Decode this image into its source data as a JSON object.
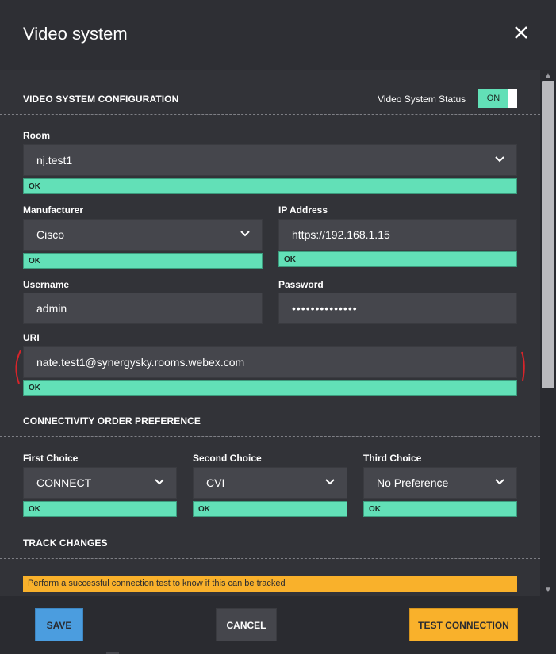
{
  "header": {
    "title": "Video system",
    "close_icon": "close-icon"
  },
  "config": {
    "section_title": "VIDEO SYSTEM CONFIGURATION",
    "status_label": "Video System Status",
    "status_toggle": "ON"
  },
  "room": {
    "label": "Room",
    "value": "nj.test1",
    "status": "OK"
  },
  "manufacturer": {
    "label": "Manufacturer",
    "value": "Cisco",
    "status": "OK"
  },
  "ip": {
    "label": "IP Address",
    "value": "https://192.168.1.15",
    "status": "OK"
  },
  "username": {
    "label": "Username",
    "value": "admin"
  },
  "password": {
    "label": "Password",
    "value": "••••••••••••••"
  },
  "uri": {
    "label": "URI",
    "value": "nate.test1@synergysky.rooms.webex.com",
    "status": "OK"
  },
  "connectivity": {
    "section_title": "CONNECTIVITY ORDER PREFERENCE",
    "first": {
      "label": "First Choice",
      "value": "CONNECT",
      "status": "OK"
    },
    "second": {
      "label": "Second Choice",
      "value": "CVI",
      "status": "OK"
    },
    "third": {
      "label": "Third Choice",
      "value": "No Preference",
      "status": "OK"
    }
  },
  "track": {
    "section_title": "TRACK CHANGES",
    "warning": "Perform a successful connection test to know if this can be tracked"
  },
  "footer": {
    "save_label": "SAVE",
    "cancel_label": "CANCEL",
    "test_label": "TEST CONNECTION"
  },
  "colors": {
    "ok_green": "#62e0b7",
    "warning_orange": "#f9b12b",
    "save_blue": "#4b9ddf",
    "annotation_red": "#d8242a"
  }
}
